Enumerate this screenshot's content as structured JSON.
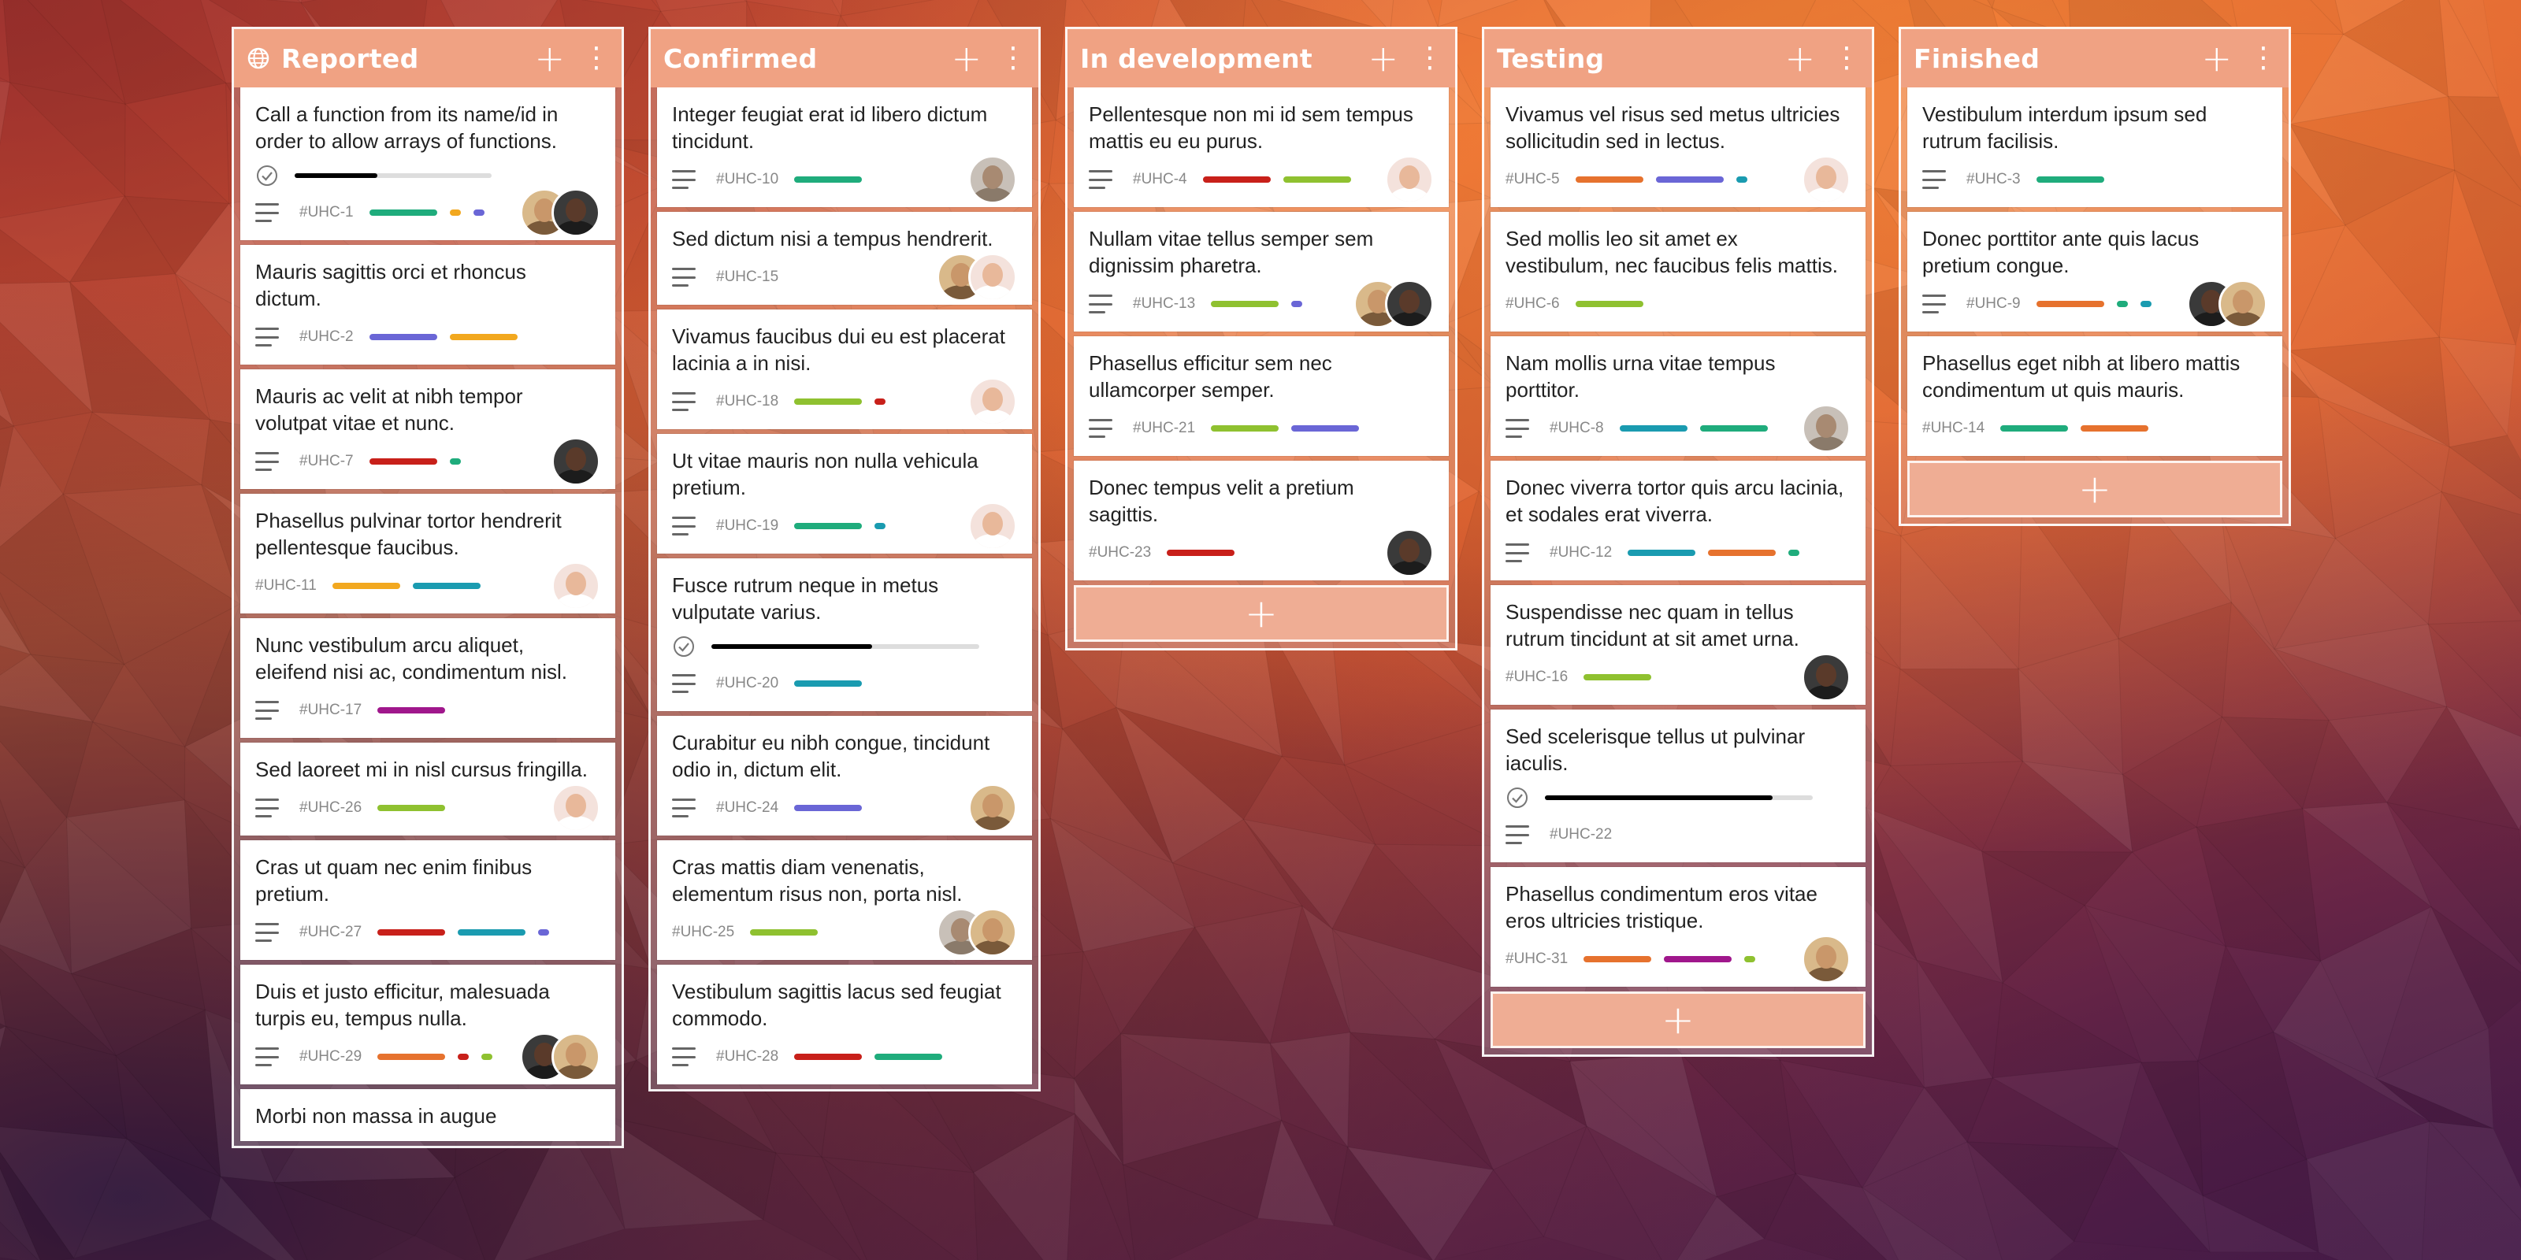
{
  "theme": {
    "header_color": "#f0a283",
    "add_button_color": "#efad94",
    "text_color": "#222222"
  },
  "columns": [
    {
      "title": "Reported",
      "show_globe": true,
      "add_label": "+",
      "more_label": "⋮",
      "cards": [
        {
          "title": "Call a function from its name/id in order to allow arrays of functions.",
          "id": "#UHC-1",
          "checklist": 0.42,
          "labels": [
            "#1fac7c",
            "#f2a81f",
            "#6a66d6"
          ],
          "label_widths": [
            86,
            14,
            14
          ],
          "menu": true,
          "avatars": [
            "female-blonde",
            "male-dark"
          ]
        },
        {
          "title": "Mauris sagittis orci et rhoncus dictum.",
          "id": "#UHC-2",
          "labels": [
            "#6a66d6",
            "#f2a81f"
          ],
          "label_widths": [
            86,
            86
          ],
          "menu": true,
          "avatars": []
        },
        {
          "title": "Mauris ac velit at nibh tempor volutpat vitae et nunc.",
          "id": "#UHC-7",
          "labels": [
            "#c8201a",
            "#1fac7c"
          ],
          "label_widths": [
            86,
            14
          ],
          "menu": true,
          "avatars": [
            "male-dark"
          ]
        },
        {
          "title": "Phasellus pulvinar tortor hendrerit pellentesque faucibus.",
          "id": "#UHC-11",
          "labels": [
            "#f2a81f",
            "#1a9bb0"
          ],
          "label_widths": [
            86,
            86
          ],
          "menu": false,
          "avatars": [
            "female-white"
          ]
        },
        {
          "title": "Nunc vestibulum arcu aliquet, eleifend nisi ac, condimentum nisl.",
          "id": "#UHC-17",
          "labels": [
            "#a0178c"
          ],
          "label_widths": [
            86
          ],
          "menu": true,
          "avatars": []
        },
        {
          "title": "Sed laoreet mi in nisl cursus fringilla.",
          "id": "#UHC-26",
          "labels": [
            "#8fc130"
          ],
          "label_widths": [
            86
          ],
          "menu": true,
          "avatars": [
            "female-white"
          ]
        },
        {
          "title": "Cras ut quam nec enim finibus pretium.",
          "id": "#UHC-27",
          "labels": [
            "#c8201a",
            "#1a9bb0",
            "#6a66d6"
          ],
          "label_widths": [
            86,
            86,
            14
          ],
          "menu": true,
          "avatars": []
        },
        {
          "title": "Duis et justo efficitur, malesuada turpis eu, tempus nulla.",
          "id": "#UHC-29",
          "labels": [
            "#e6722e",
            "#c8201a",
            "#8fc130"
          ],
          "label_widths": [
            86,
            14,
            14
          ],
          "menu": true,
          "avatars": [
            "male-dark",
            "female-blonde"
          ]
        },
        {
          "title": "Morbi non massa in augue",
          "id": "",
          "labels": [],
          "label_widths": [],
          "menu": false,
          "avatars": []
        }
      ]
    },
    {
      "title": "Confirmed",
      "show_globe": false,
      "add_label": "+",
      "more_label": "⋮",
      "cards": [
        {
          "title": "Integer feugiat erat id libero dictum tincidunt.",
          "id": "#UHC-10",
          "labels": [
            "#1fac7c"
          ],
          "label_widths": [
            86
          ],
          "menu": true,
          "avatars": [
            "female-grey"
          ]
        },
        {
          "title": "Sed dictum nisi a tempus hendrerit.",
          "id": "#UHC-15",
          "labels": [],
          "label_widths": [],
          "menu": true,
          "avatars": [
            "female-blonde",
            "female-white"
          ]
        },
        {
          "title": "Vivamus faucibus dui eu est placerat lacinia a in nisi.",
          "id": "#UHC-18",
          "labels": [
            "#8fc130",
            "#c8201a"
          ],
          "label_widths": [
            86,
            14
          ],
          "menu": true,
          "avatars": [
            "female-white"
          ]
        },
        {
          "title": "Ut vitae mauris non nulla vehicula pretium.",
          "id": "#UHC-19",
          "labels": [
            "#1fac7c",
            "#1a9bb0"
          ],
          "label_widths": [
            86,
            14
          ],
          "menu": true,
          "avatars": [
            "female-white"
          ]
        },
        {
          "title": "Fusce rutrum neque in metus vulputate varius.",
          "id": "#UHC-20",
          "checklist": 0.6,
          "labels": [
            "#1a9bb0"
          ],
          "label_widths": [
            86
          ],
          "menu": true,
          "avatars": []
        },
        {
          "title": "Curabitur eu nibh congue, tincidunt odio in, dictum elit.",
          "id": "#UHC-24",
          "labels": [
            "#6a66d6"
          ],
          "label_widths": [
            86
          ],
          "menu": true,
          "avatars": [
            "female-blonde"
          ]
        },
        {
          "title": "Cras mattis diam venenatis, elementum risus non, porta nisl.",
          "id": "#UHC-25",
          "labels": [
            "#8fc130"
          ],
          "label_widths": [
            86
          ],
          "menu": false,
          "avatars": [
            "female-grey",
            "female-blonde"
          ]
        },
        {
          "title": "Vestibulum sagittis lacus sed feugiat commodo.",
          "id": "#UHC-28",
          "labels": [
            "#c8201a",
            "#1fac7c"
          ],
          "label_widths": [
            86,
            86
          ],
          "menu": true,
          "avatars": []
        }
      ]
    },
    {
      "title": "In development",
      "show_globe": false,
      "add_label": "+",
      "more_label": "⋮",
      "add_card_label": "+",
      "cards": [
        {
          "title": "Pellentesque non mi id sem tempus mattis eu eu purus.",
          "id": "#UHC-4",
          "labels": [
            "#c8201a",
            "#8fc130"
          ],
          "label_widths": [
            86,
            86
          ],
          "menu": true,
          "avatars": [
            "female-white"
          ]
        },
        {
          "title": "Nullam vitae tellus semper sem dignissim pharetra.",
          "id": "#UHC-13",
          "labels": [
            "#8fc130",
            "#6a66d6"
          ],
          "label_widths": [
            86,
            14
          ],
          "menu": true,
          "avatars": [
            "female-blonde",
            "male-dark"
          ]
        },
        {
          "title": "Phasellus efficitur sem nec ullamcorper semper.",
          "id": "#UHC-21",
          "labels": [
            "#8fc130",
            "#6a66d6"
          ],
          "label_widths": [
            86,
            86
          ],
          "menu": true,
          "avatars": []
        },
        {
          "title": "Donec tempus velit a pretium sagittis.",
          "id": "#UHC-23",
          "labels": [
            "#c8201a"
          ],
          "label_widths": [
            86
          ],
          "menu": false,
          "avatars": [
            "male-dark"
          ]
        }
      ]
    },
    {
      "title": "Testing",
      "show_globe": false,
      "add_label": "+",
      "more_label": "⋮",
      "add_card_label": "+",
      "cards": [
        {
          "title": "Vivamus vel risus sed metus ultricies sollicitudin sed in lectus.",
          "id": "#UHC-5",
          "labels": [
            "#e6722e",
            "#6a66d6",
            "#1a9bb0"
          ],
          "label_widths": [
            86,
            86,
            14
          ],
          "menu": false,
          "avatars": [
            "female-white"
          ]
        },
        {
          "title": "Sed mollis leo sit amet ex vestibulum, nec faucibus felis mattis.",
          "id": "#UHC-6",
          "labels": [
            "#8fc130"
          ],
          "label_widths": [
            86
          ],
          "menu": false,
          "avatars": []
        },
        {
          "title": "Nam mollis urna vitae tempus porttitor.",
          "id": "#UHC-8",
          "labels": [
            "#1a9bb0",
            "#1fac7c"
          ],
          "label_widths": [
            86,
            86
          ],
          "menu": true,
          "avatars": [
            "female-grey"
          ]
        },
        {
          "title": "Donec viverra tortor quis arcu lacinia, et sodales erat viverra.",
          "id": "#UHC-12",
          "labels": [
            "#1a9bb0",
            "#e6722e",
            "#1fac7c"
          ],
          "label_widths": [
            86,
            86,
            14
          ],
          "menu": true,
          "avatars": []
        },
        {
          "title": "Suspendisse nec quam in tellus rutrum tincidunt at sit amet urna.",
          "id": "#UHC-16",
          "labels": [
            "#8fc130"
          ],
          "label_widths": [
            86
          ],
          "menu": false,
          "avatars": [
            "male-dark"
          ]
        },
        {
          "title": "Sed scelerisque tellus ut pulvinar iaculis.",
          "id": "#UHC-22",
          "checklist": 0.85,
          "labels": [],
          "label_widths": [],
          "menu": true,
          "avatars": []
        },
        {
          "title": "Phasellus condimentum eros vitae eros ultricies tristique.",
          "id": "#UHC-31",
          "labels": [
            "#e6722e",
            "#a0178c",
            "#8fc130"
          ],
          "label_widths": [
            86,
            86,
            14
          ],
          "menu": false,
          "avatars": [
            "female-blonde"
          ]
        }
      ]
    },
    {
      "title": "Finished",
      "show_globe": false,
      "add_label": "+",
      "more_label": "⋮",
      "add_card_label": "+",
      "cards": [
        {
          "title": "Vestibulum interdum ipsum sed rutrum facilisis.",
          "id": "#UHC-3",
          "labels": [
            "#1fac7c"
          ],
          "label_widths": [
            86
          ],
          "menu": true,
          "avatars": []
        },
        {
          "title": "Donec porttitor ante quis lacus pretium congue.",
          "id": "#UHC-9",
          "labels": [
            "#e6722e",
            "#1fac7c",
            "#1a9bb0"
          ],
          "label_widths": [
            86,
            14,
            14
          ],
          "menu": true,
          "avatars": [
            "male-dark",
            "female-blonde"
          ]
        },
        {
          "title": "Phasellus eget nibh at libero mattis condimentum ut quis mauris.",
          "id": "#UHC-14",
          "labels": [
            "#1fac7c",
            "#e6722e"
          ],
          "label_widths": [
            86,
            86
          ],
          "menu": false,
          "avatars": []
        }
      ]
    }
  ]
}
